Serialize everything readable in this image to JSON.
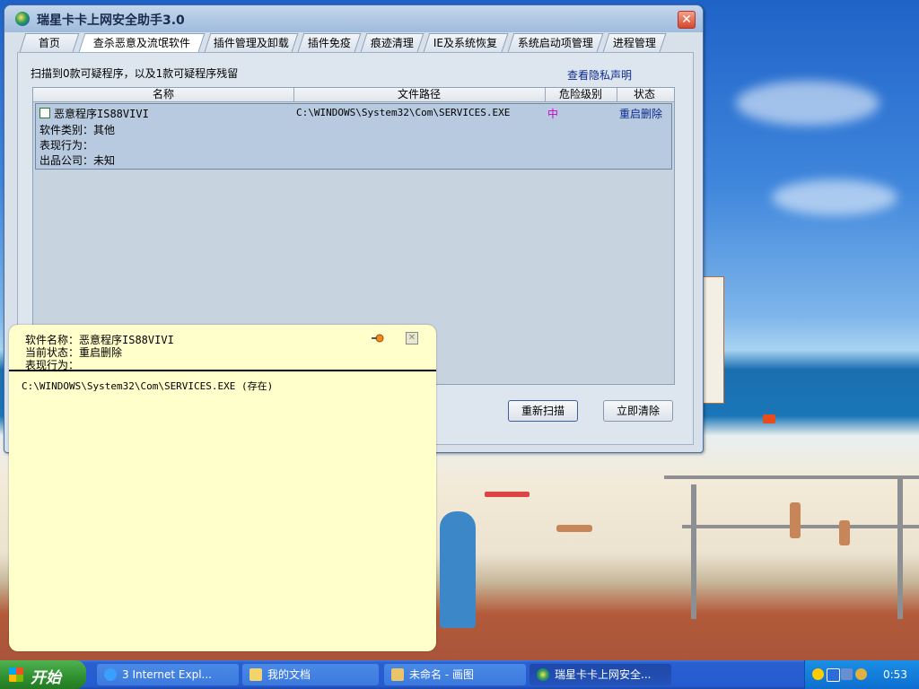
{
  "window": {
    "title": "瑞星卡卡上网安全助手3.0",
    "close_label": "✕"
  },
  "tabs": [
    {
      "label": "首页"
    },
    {
      "label": "查杀恶意及流氓软件"
    },
    {
      "label": "插件管理及卸载"
    },
    {
      "label": "插件免疫"
    },
    {
      "label": "痕迹清理"
    },
    {
      "label": "IE及系统恢复"
    },
    {
      "label": "系统启动项管理"
    },
    {
      "label": "进程管理"
    }
  ],
  "scan": {
    "summary": "扫描到0款可疑程序，以及1款可疑程序残留",
    "privacy_link": "查看隐私声明"
  },
  "table": {
    "columns": [
      "名称",
      "文件路径",
      "危险级别",
      "状态"
    ],
    "rows": [
      {
        "name": "恶意程序IS88VIVI",
        "path": "C:\\WINDOWS\\System32\\Com\\SERVICES.EXE",
        "level": "中",
        "status": "重启删除",
        "category": "软件类别：其他",
        "behavior": "表现行为：",
        "publisher": "出品公司：未知"
      }
    ]
  },
  "buttons": {
    "rescan": "重新扫描",
    "clean_now": "立即清除"
  },
  "popup": {
    "software_name": "软件名称：恶意程序IS88VIVI",
    "current_status": "当前状态：重启删除",
    "behavior": "表现行为：",
    "path_line": "C:\\WINDOWS\\System32\\Com\\SERVICES.EXE  (存在)",
    "close_label": "✕"
  },
  "taskbar": {
    "start_label": "开始",
    "tasks": [
      {
        "label": "3 Internet Expl...",
        "icon_color": "#3aa0ff"
      },
      {
        "label": "我的文档",
        "icon_color": "#f3d36b"
      },
      {
        "label": "未命名 - 画图",
        "icon_color": "#e9c46a"
      },
      {
        "label": "瑞星卡卡上网安全...",
        "icon_color": "#2a9d4f"
      }
    ],
    "clock": "0:53"
  }
}
